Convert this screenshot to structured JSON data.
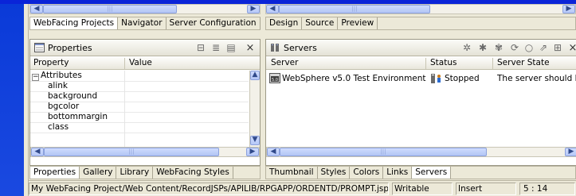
{
  "top_left_tabs": [
    "WebFacing Projects",
    "Navigator",
    "Server Configuration"
  ],
  "top_right_tabs": [
    "Design",
    "Source",
    "Preview"
  ],
  "properties_panel": {
    "title": "Properties",
    "columns": [
      "Property",
      "Value"
    ],
    "rows": [
      "Attributes",
      "alink",
      "background",
      "bgcolor",
      "bottommargin",
      "class"
    ],
    "expander": "−",
    "toolbar_icons": [
      "group-icon",
      "filter-icon",
      "restore-default-icon"
    ],
    "close": "×"
  },
  "properties_tabs": [
    "Properties",
    "Gallery",
    "Library",
    "WebFacing Styles"
  ],
  "servers_panel": {
    "title": "Servers",
    "columns": [
      "Server",
      "Status",
      "Server State"
    ],
    "rows": [
      {
        "server": "WebSphere v5.0 Test Environment",
        "status": "Stopped",
        "state": "The server should b"
      }
    ],
    "close": "×"
  },
  "bottom_right_tabs": [
    "Thumbnail",
    "Styles",
    "Colors",
    "Links",
    "Servers"
  ],
  "status_bar": {
    "path": "My WebFacing Project/Web Content/RecordJSPs/APILIB/RPGAPP/ORDENTD/PROMPT.jsp",
    "mode": "Writable",
    "insert": "Insert",
    "position": "5 : 14"
  },
  "colors": {
    "window_frame_blue": "#0a24d8",
    "panel_background": "#ece9d8",
    "scroll_blue": "#b6c8f8"
  }
}
